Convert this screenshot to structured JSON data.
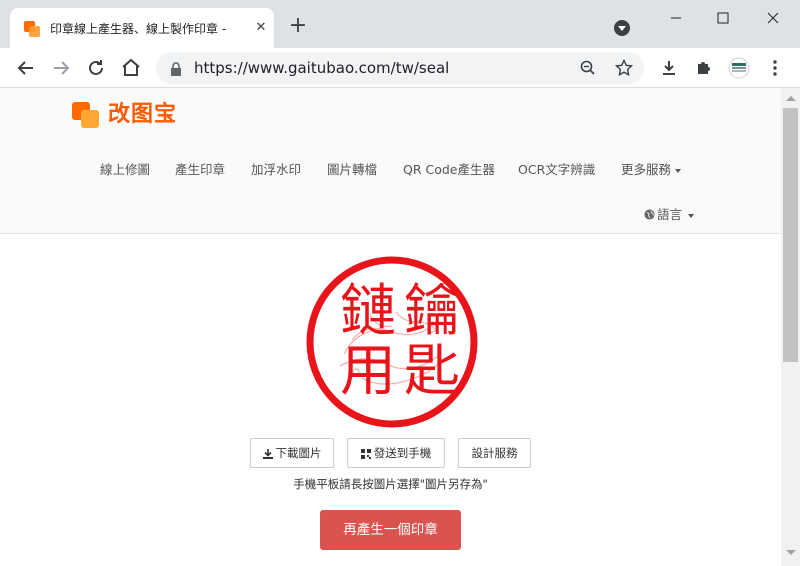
{
  "browser": {
    "tab_title": "印章線上產生器、線上製作印章 -",
    "url": "https://www.gaitubao.com/tw/seal",
    "accent_color": "#ff6a00"
  },
  "site": {
    "logo_text": "改图宝",
    "nav": [
      "線上修圖",
      "產生印章",
      "加浮水印",
      "圖片轉檔",
      "QR Code產生器",
      "OCR文字辨識",
      "更多服務"
    ],
    "language_label": "語言"
  },
  "seal": {
    "chars": [
      "鑰",
      "匙",
      "鏈",
      "用"
    ],
    "color": "#e8141a"
  },
  "actions": {
    "download_label": "下載圖片",
    "send_label": "發送到手機",
    "design_label": "設計服務",
    "hint": "手機平板請長按圖片選擇\"圖片另存為\"",
    "regenerate_label": "再產生一個印章",
    "regenerate_color": "#d9534f"
  }
}
